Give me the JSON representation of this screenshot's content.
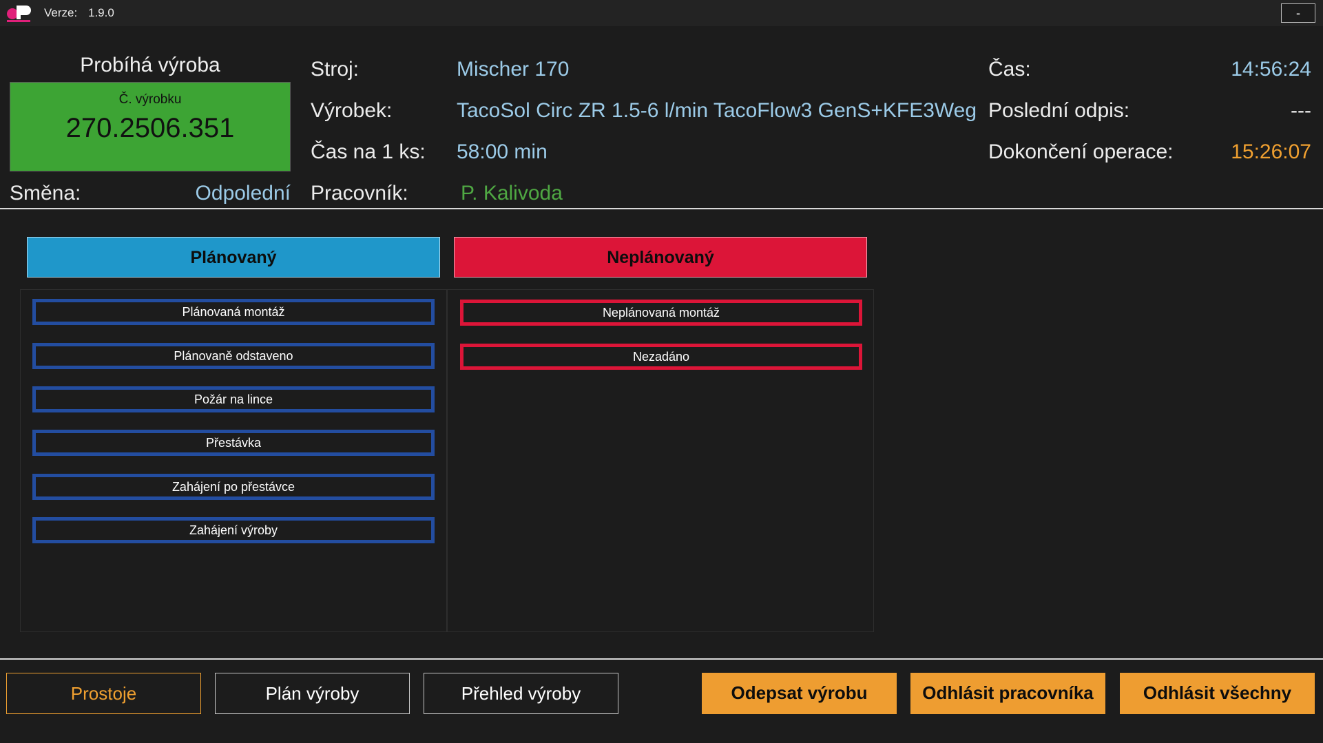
{
  "titlebar": {
    "version_label": "Verze:",
    "version_value": "1.9.0",
    "minimize_label": "-"
  },
  "production": {
    "title": "Probíhá výroba",
    "product_no_label": "Č. výrobku",
    "product_no": "270.2506.351",
    "box_color": "#3da434"
  },
  "shift": {
    "label": "Směna:",
    "value": "Odpolední"
  },
  "machine": {
    "label": "Stroj:",
    "value": "Mischer 170"
  },
  "product": {
    "label": "Výrobek:",
    "value": "TacoSol Circ ZR 1.5-6 l/min TacoFlow3 GenS+KFE3Weg"
  },
  "time_per_piece": {
    "label": "Čas na 1 ks:",
    "value": "58:00 min"
  },
  "worker": {
    "label": "Pracovník:",
    "value": "P. Kalivoda"
  },
  "clock": {
    "label": "Čas:",
    "value": "14:56:24"
  },
  "last_writeoff": {
    "label": "Poslední odpis:",
    "value": "---"
  },
  "completion": {
    "label": "Dokončení operace:",
    "value": "15:26:07"
  },
  "categories": {
    "planned": {
      "label": "Plánovaný",
      "color": "#1f97ca"
    },
    "unplanned": {
      "label": "Neplánovaný",
      "color": "#dc1538"
    }
  },
  "planned_items": [
    "Plánovaná montáž",
    "Plánovaně odstaveno",
    "Požár na lince",
    "Přestávka",
    "Zahájení po přestávce",
    "Zahájení výroby"
  ],
  "unplanned_items": [
    "Neplánovaná montáž",
    "Nezadáno"
  ],
  "bottom_buttons": {
    "downtimes": "Prostoje",
    "production_plan": "Plán výroby",
    "production_overview": "Přehled výroby",
    "write_off": "Odepsat výrobu",
    "logout_worker": "Odhlásit pracovníka",
    "logout_all": "Odhlásit všechny"
  },
  "colors": {
    "accent_orange": "#ee9d31",
    "value_blue": "#9ccbe8",
    "value_green": "#4fa843",
    "planned_border": "#234da0"
  }
}
